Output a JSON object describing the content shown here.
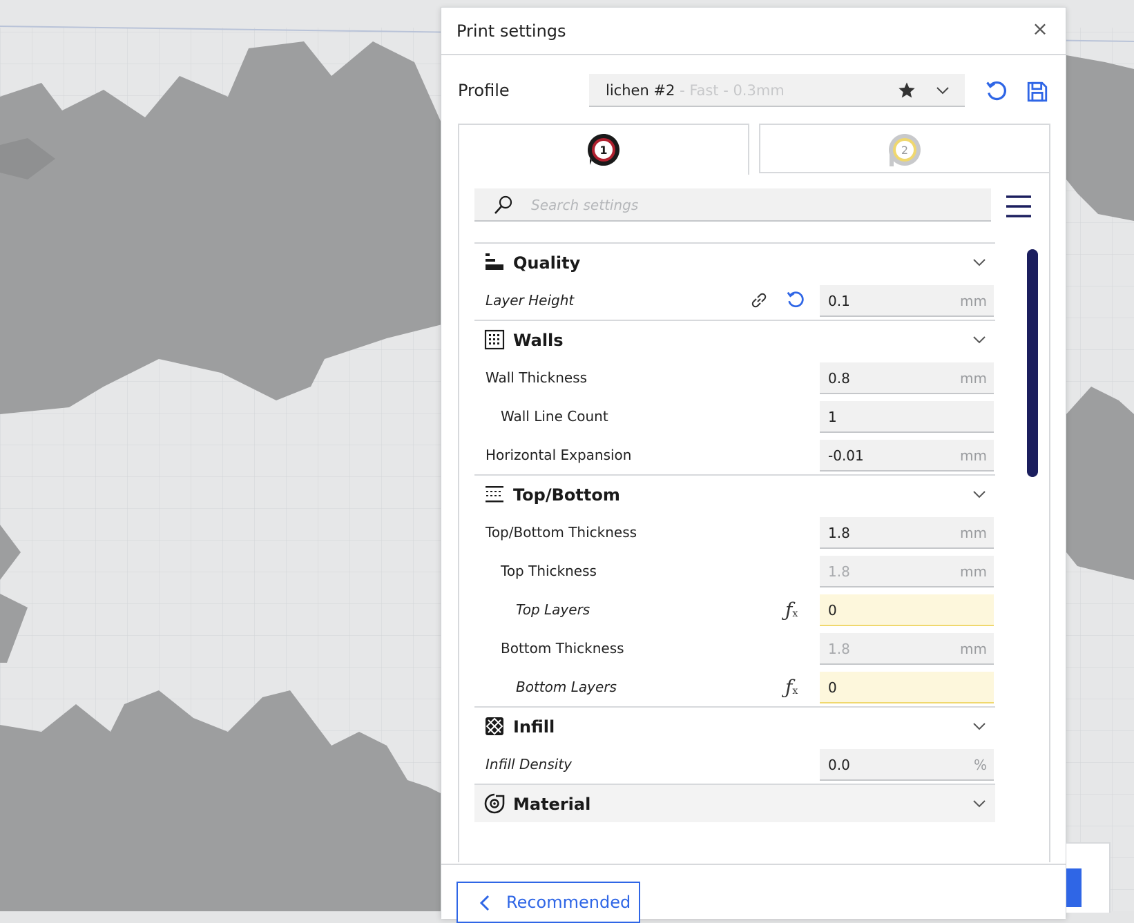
{
  "panel": {
    "title": "Print settings",
    "close_glyph": "×"
  },
  "profile": {
    "label": "Profile",
    "name": "lichen #2",
    "detail": " - Fast - 0.3mm"
  },
  "extruder_tabs": [
    {
      "number": "1",
      "color": "#b0212f"
    },
    {
      "number": "2",
      "color": "#f0d86e"
    }
  ],
  "search": {
    "placeholder": "Search settings"
  },
  "categories": {
    "quality": {
      "title": "Quality",
      "settings": [
        {
          "label": "Layer Height",
          "value": "0.1",
          "unit": "mm"
        }
      ]
    },
    "walls": {
      "title": "Walls",
      "settings": [
        {
          "label": "Wall Thickness",
          "value": "0.8",
          "unit": "mm"
        },
        {
          "label": "Wall Line Count",
          "value": "1",
          "unit": ""
        },
        {
          "label": "Horizontal Expansion",
          "value": "-0.01",
          "unit": "mm"
        }
      ]
    },
    "top_bottom": {
      "title": "Top/Bottom",
      "settings": [
        {
          "label": "Top/Bottom Thickness",
          "value": "1.8",
          "unit": "mm"
        },
        {
          "label": "Top Thickness",
          "value": "1.8",
          "unit": "mm"
        },
        {
          "label": "Top Layers",
          "value": "0",
          "unit": ""
        },
        {
          "label": "Bottom Thickness",
          "value": "1.8",
          "unit": "mm"
        },
        {
          "label": "Bottom Layers",
          "value": "0",
          "unit": ""
        }
      ]
    },
    "infill": {
      "title": "Infill",
      "settings": [
        {
          "label": "Infill Density",
          "value": "0.0",
          "unit": "%"
        }
      ]
    },
    "material": {
      "title": "Material"
    }
  },
  "footer": {
    "recommended_label": "Recommended"
  },
  "colors": {
    "accent": "#2f66e6",
    "scrollbar": "#1b1e5e",
    "warning_field": "#fdf7dc"
  }
}
